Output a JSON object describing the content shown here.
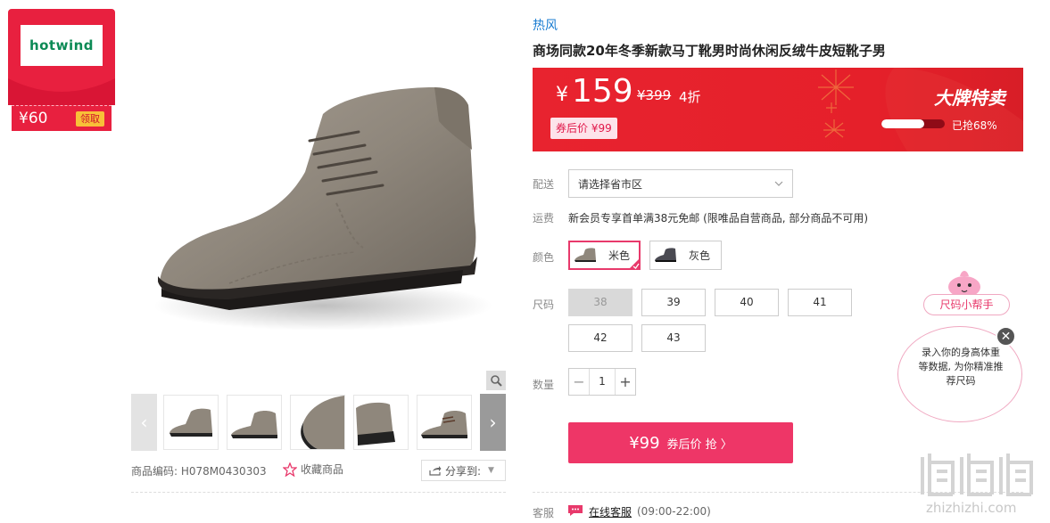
{
  "coupon": {
    "logo": "hotwind",
    "amount": "¥60",
    "claim_label": "领取"
  },
  "gallery": {
    "zoom_icon": "zoom-icon",
    "prev_icon": "chevron-left-icon",
    "next_icon": "chevron-right-icon"
  },
  "product_meta": {
    "sku_label": "商品编码:",
    "sku_value": "H078M0430303",
    "favorite_label": "收藏商品",
    "share_label": "分享到:"
  },
  "brand": "热风",
  "title": "商场同款20年冬季新款马丁靴男时尚休闲反绒牛皮短靴子男",
  "price": {
    "currency": "¥",
    "current": "159",
    "original": "¥399",
    "discount": "4折",
    "after_coupon": "券后价 ¥99",
    "promo_title": "大牌特卖",
    "sold_progress": 0.68,
    "sold_text": "已抢68%"
  },
  "shipping": {
    "label": "配送",
    "placeholder": "请选择省市区"
  },
  "freight": {
    "label": "运费",
    "text": "新会员专享首单满38元免邮 (限唯品自营商品, 部分商品不可用)"
  },
  "color": {
    "label": "颜色",
    "options": [
      {
        "name": "米色",
        "selected": true
      },
      {
        "name": "灰色",
        "selected": false
      }
    ]
  },
  "size": {
    "label": "尺码",
    "options": [
      {
        "value": "38",
        "available": false
      },
      {
        "value": "39",
        "available": true
      },
      {
        "value": "40",
        "available": true
      },
      {
        "value": "41",
        "available": true
      },
      {
        "value": "42",
        "available": true
      },
      {
        "value": "43",
        "available": true
      }
    ]
  },
  "quantity": {
    "label": "数量",
    "value": "1",
    "minus": "−",
    "plus": "+"
  },
  "buy_button": {
    "price": "¥99",
    "text": "券后价 抢 〉"
  },
  "service": {
    "label": "客服",
    "link": "在线客服",
    "hours": "(09:00-22:00)"
  },
  "size_helper": {
    "tag": "尺码小帮手",
    "message": "录入你的身高体重等数据, 为你精准推荐尺码",
    "close": "✕"
  },
  "watermark": "zhizhizhi.com",
  "colors": {
    "accent": "#ee3667",
    "banner_red": "#e5202a",
    "brand_link": "#1b7dd1"
  }
}
